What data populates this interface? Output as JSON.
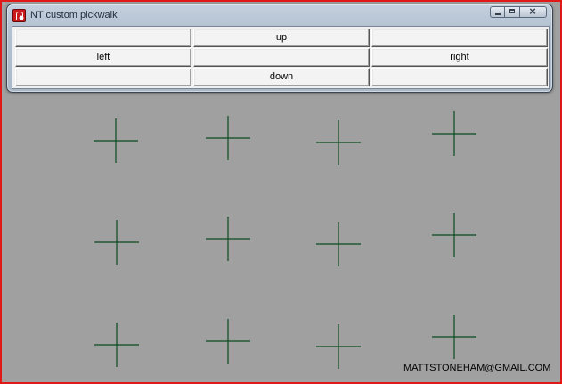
{
  "window": {
    "title": "NT custom pickwalk",
    "icon": "app-red-icon"
  },
  "pickwalk": {
    "rows": [
      [
        "",
        "up",
        ""
      ],
      [
        "left",
        "",
        "right"
      ],
      [
        "",
        "down",
        ""
      ]
    ]
  },
  "viewport": {
    "marker_color": "#0b4a1f",
    "background": "#a0a0a0",
    "border_color": "#e01818",
    "credit": "MATTSTONEHAM@GMAIL.COM"
  }
}
